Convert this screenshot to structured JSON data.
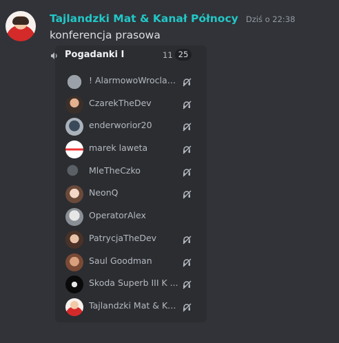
{
  "message": {
    "author": "Tajlandzki Mat & Kanał Północy",
    "timestamp": "Dziś o 22:38",
    "text": "konferencja prasowa"
  },
  "voice_channel": {
    "icon": "voice-channel-icon",
    "name": "Pogadanki I",
    "user_count": "11",
    "user_limit": "25",
    "members": [
      {
        "name": "! AlarmowoWroclaw !",
        "deafened": true
      },
      {
        "name": "CzarekTheDev",
        "deafened": true
      },
      {
        "name": "enderworior20",
        "deafened": true
      },
      {
        "name": "marek laweta",
        "deafened": true
      },
      {
        "name": "MleTheCzko",
        "deafened": true
      },
      {
        "name": "NeonQ",
        "deafened": true
      },
      {
        "name": "OperatorAlex",
        "deafened": false
      },
      {
        "name": "PatrycjaTheDev",
        "deafened": true
      },
      {
        "name": "Saul Goodman",
        "deafened": true
      },
      {
        "name": "Skoda Superb III K ...",
        "deafened": true
      },
      {
        "name": "Tajlandzki Mat & Ka...",
        "deafened": true
      }
    ]
  },
  "colors": {
    "background": "#313338",
    "card": "#2b2d31",
    "username": "#23c7c7",
    "muted_text": "#b5bac1",
    "timestamp": "#949ba4"
  }
}
